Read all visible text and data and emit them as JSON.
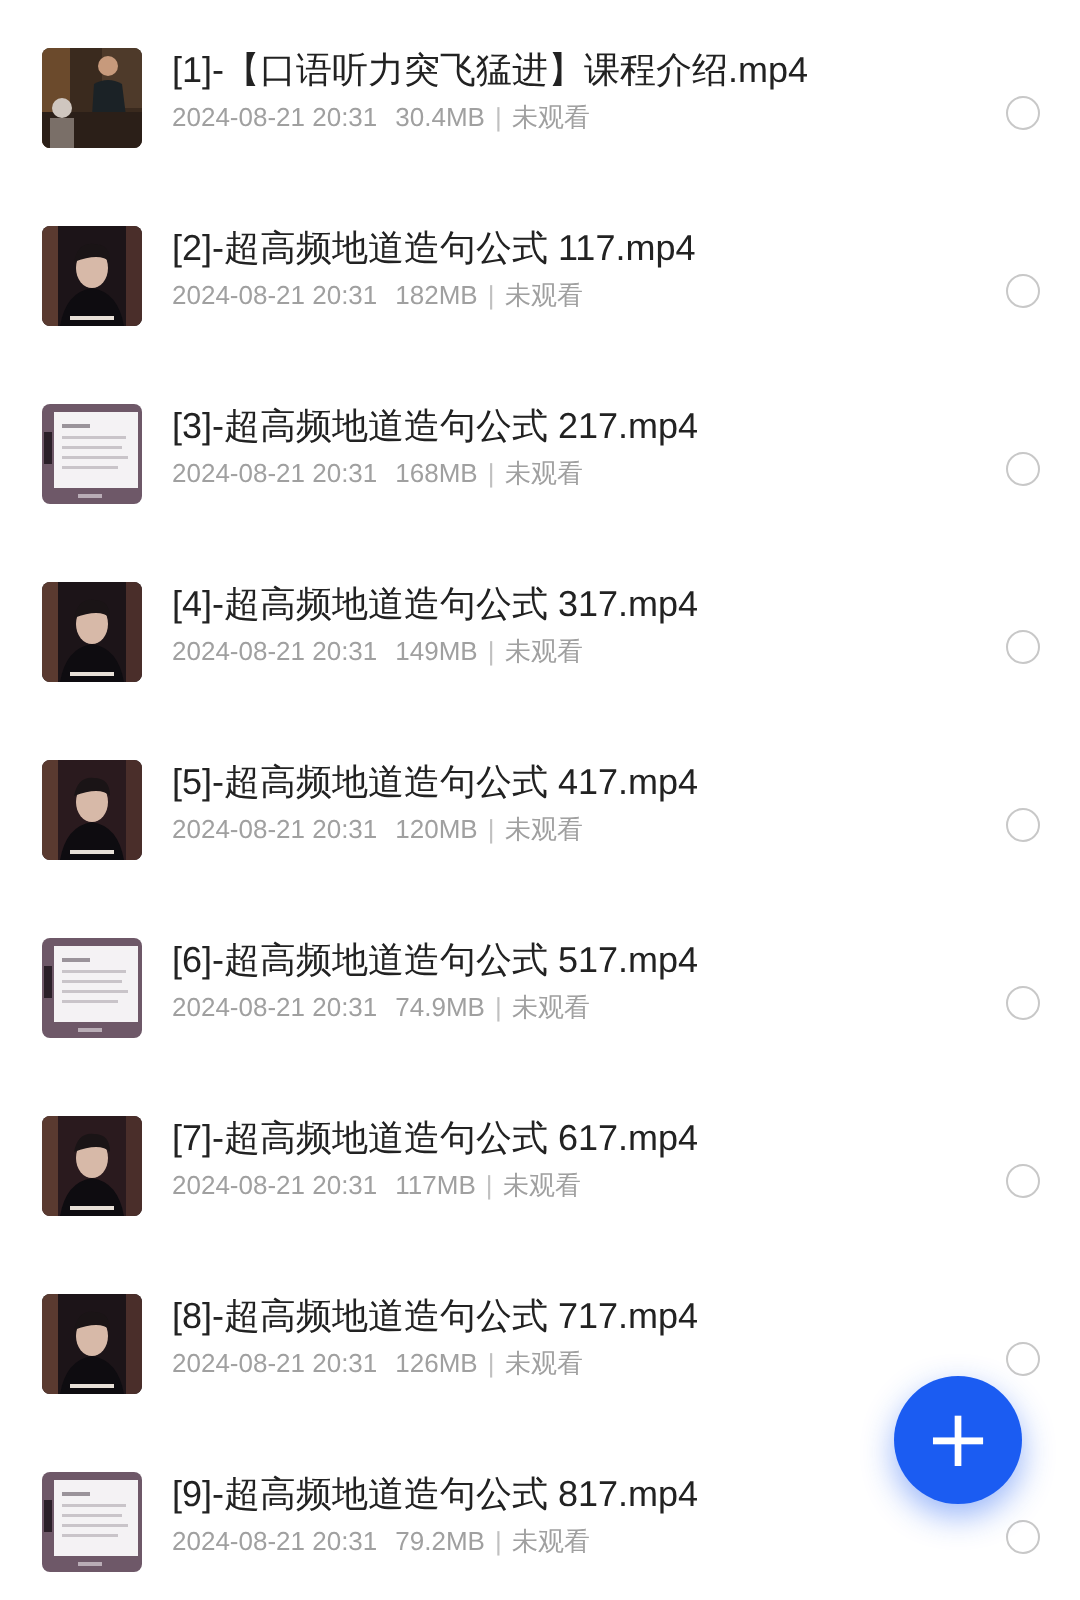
{
  "files": [
    {
      "title": "[1]-【口语听力突飞猛进】课程介绍.mp4",
      "date": "2024-08-21 20:31",
      "size": "30.4MB",
      "separator": "|",
      "status": "未观看",
      "selected": false
    },
    {
      "title": "[2]-超高频地道造句公式 117.mp4",
      "date": "2024-08-21 20:31",
      "size": "182MB",
      "separator": "|",
      "status": "未观看",
      "selected": false
    },
    {
      "title": "[3]-超高频地道造句公式 217.mp4",
      "date": "2024-08-21 20:31",
      "size": "168MB",
      "separator": "|",
      "status": "未观看",
      "selected": false
    },
    {
      "title": "[4]-超高频地道造句公式 317.mp4",
      "date": "2024-08-21 20:31",
      "size": "149MB",
      "separator": "|",
      "status": "未观看",
      "selected": false
    },
    {
      "title": "[5]-超高频地道造句公式 417.mp4",
      "date": "2024-08-21 20:31",
      "size": "120MB",
      "separator": "|",
      "status": "未观看",
      "selected": false
    },
    {
      "title": "[6]-超高频地道造句公式 517.mp4",
      "date": "2024-08-21 20:31",
      "size": "74.9MB",
      "separator": "|",
      "status": "未观看",
      "selected": false
    },
    {
      "title": "[7]-超高频地道造句公式 617.mp4",
      "date": "2024-08-21 20:31",
      "size": "117MB",
      "separator": "|",
      "status": "未观看",
      "selected": false
    },
    {
      "title": "[8]-超高频地道造句公式 717.mp4",
      "date": "2024-08-21 20:31",
      "size": "126MB",
      "separator": "|",
      "status": "未观看",
      "selected": false
    },
    {
      "title": "[9]-超高频地道造句公式 817.mp4",
      "date": "2024-08-21 20:31",
      "size": "79.2MB",
      "separator": "|",
      "status": "未观看",
      "selected": false
    }
  ],
  "fab": {
    "label": "+"
  }
}
